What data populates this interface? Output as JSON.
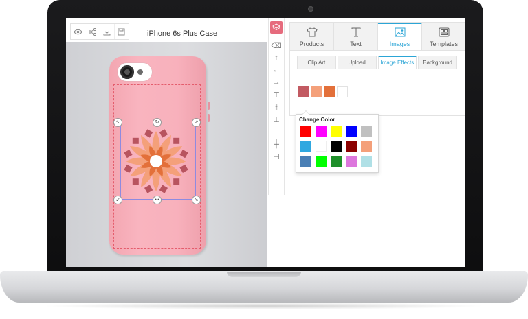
{
  "editor": {
    "product_title": "iPhone 6s Plus Case",
    "toolbar_icons": [
      "eye-icon",
      "share-icon",
      "download-icon",
      "save-icon"
    ]
  },
  "tool_column": {
    "icons": [
      "layers-icon",
      "eraser-icon",
      "arrow-up-icon",
      "arrow-left-icon",
      "arrow-right-icon",
      "align-top-icon",
      "align-middle-icon",
      "align-bottom-icon",
      "align-left-icon",
      "align-center-icon",
      "align-right-icon"
    ]
  },
  "panel": {
    "tabs": [
      {
        "label": "Products",
        "icon": "tshirt-icon",
        "active": false
      },
      {
        "label": "Text",
        "icon": "text-icon",
        "active": false
      },
      {
        "label": "Images",
        "icon": "image-icon",
        "active": true
      },
      {
        "label": "Templates",
        "icon": "templates-icon",
        "active": false
      }
    ],
    "subtabs": [
      {
        "label": "Clip Art",
        "active": false
      },
      {
        "label": "Upload",
        "active": false
      },
      {
        "label": "Image Effects",
        "active": true
      },
      {
        "label": "Background",
        "active": false
      }
    ],
    "image_colors": [
      "#c25a62",
      "#f4a07a",
      "#e3703a",
      "#ffffff"
    ]
  },
  "color_popup": {
    "title": "Change Color",
    "palette": [
      "#ff0000",
      "#ff00ff",
      "#ffff00",
      "#0000ff",
      "#c0c0c0",
      "#2fa8e0",
      "#ffffff",
      "#000000",
      "#8b0000",
      "#f4a07a",
      "#4a7fb5",
      "#00ff00",
      "#1e8f2a",
      "#dd77dd",
      "#b0e0e6"
    ]
  },
  "colors": {
    "accent": "#2ba5d6",
    "case_pink": "#f8b1bc",
    "layers_button": "#e66b7d"
  }
}
